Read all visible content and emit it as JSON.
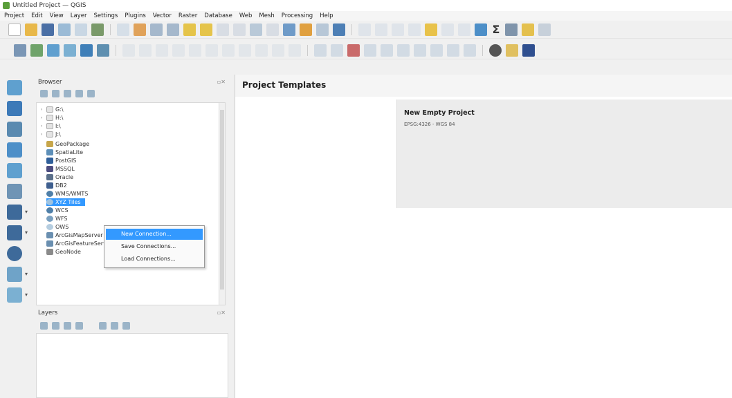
{
  "window": {
    "title": "Untitled Project — QGIS"
  },
  "menubar": [
    "Project",
    "Edit",
    "View",
    "Layer",
    "Settings",
    "Plugins",
    "Vector",
    "Raster",
    "Database",
    "Web",
    "Mesh",
    "Processing",
    "Help"
  ],
  "browser": {
    "title": "Browser",
    "float_glyph": "▫✕",
    "items": [
      {
        "expand": "›",
        "label": "G:\\"
      },
      {
        "expand": "›",
        "label": "H:\\"
      },
      {
        "expand": "›",
        "label": "I:\\"
      },
      {
        "expand": "›",
        "label": "J:\\"
      },
      {
        "expand": "",
        "label": "GeoPackage"
      },
      {
        "expand": "",
        "label": "SpatiaLite"
      },
      {
        "expand": "",
        "label": "PostGIS"
      },
      {
        "expand": "",
        "label": "MSSQL"
      },
      {
        "expand": "",
        "label": "Oracle"
      },
      {
        "expand": "",
        "label": "DB2"
      },
      {
        "expand": "",
        "label": "WMS/WMTS"
      },
      {
        "expand": "",
        "label": "XYZ Tiles"
      },
      {
        "expand": "",
        "label": "WCS"
      },
      {
        "expand": "",
        "label": "WFS"
      },
      {
        "expand": "",
        "label": "OWS"
      },
      {
        "expand": "",
        "label": "ArcGisMapServer"
      },
      {
        "expand": "",
        "label": "ArcGisFeatureServer"
      },
      {
        "expand": "",
        "label": "GeoNode"
      }
    ]
  },
  "context_menu": {
    "items": [
      "New Connection...",
      "Save Connections...",
      "Load Connections..."
    ]
  },
  "layers": {
    "title": "Layers",
    "float_glyph": "▫✕"
  },
  "main": {
    "title": "Project Templates",
    "template": {
      "name": "New Empty Project",
      "crs": "EPSG:4326 - WGS 84"
    }
  },
  "toolbar": {
    "sigma": "Σ"
  }
}
